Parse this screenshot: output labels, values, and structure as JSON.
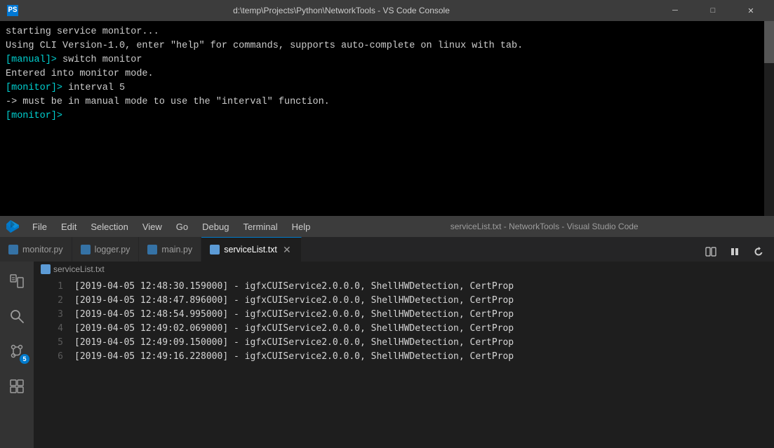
{
  "titleBar": {
    "icon": "PS",
    "title": "d:\\temp\\Projects\\Python\\NetworkTools - VS Code Console",
    "minimize": "─",
    "restore": "□",
    "close": "✕"
  },
  "terminal": {
    "lines": [
      "starting service monitor...",
      "Using CLI Version-1.0, enter \"help\" for commands, supports auto-complete on linux with tab.",
      "[manual]> switch monitor",
      "Entered into monitor mode.",
      "[monitor]> interval 5",
      "-> must be in manual mode to use the \"interval\" function.",
      "[monitor]> "
    ]
  },
  "menuBar": {
    "items": [
      "File",
      "Edit",
      "Selection",
      "View",
      "Go",
      "Debug",
      "Terminal",
      "Help"
    ],
    "centerTitle": "serviceList.txt - NetworkTools - Visual Studio Code"
  },
  "tabs": [
    {
      "id": "monitor-py",
      "label": "monitor.py",
      "iconColor": "#3572A5",
      "active": false,
      "closeable": false
    },
    {
      "id": "logger-py",
      "label": "logger.py",
      "iconColor": "#3572A5",
      "active": false,
      "closeable": false
    },
    {
      "id": "main-py",
      "label": "main.py",
      "iconColor": "#3572A5",
      "active": false,
      "closeable": false
    },
    {
      "id": "serviceList-txt",
      "label": "serviceList.txt",
      "iconColor": "#5c9bd6",
      "active": true,
      "closeable": true
    }
  ],
  "breadcrumb": {
    "filename": "serviceList.txt"
  },
  "editorLines": [
    {
      "num": 1,
      "text": "[2019-04-05 12:48:30.159000] - igfxCUIService2.0.0.0,  ShellHWDetection,  CertProp"
    },
    {
      "num": 2,
      "text": "[2019-04-05 12:48:47.896000] - igfxCUIService2.0.0.0,  ShellHWDetection,  CertProp"
    },
    {
      "num": 3,
      "text": "[2019-04-05 12:48:54.995000] - igfxCUIService2.0.0.0,  ShellHWDetection,  CertProp"
    },
    {
      "num": 4,
      "text": "[2019-04-05 12:49:02.069000] - igfxCUIService2.0.0.0,  ShellHWDetection,  CertProp"
    },
    {
      "num": 5,
      "text": "[2019-04-05 12:49:09.150000] - igfxCUIService2.0.0.0,  ShellHWDetection,  CertProp"
    },
    {
      "num": 6,
      "text": "[2019-04-05 12:49:16.228000] - igfxCUIService2.0.0.0,  ShellHWDetection,  CertProp"
    }
  ],
  "sidebar": {
    "items": [
      {
        "id": "explorer",
        "icon": "⬜",
        "iconName": "explorer-icon",
        "active": false
      },
      {
        "id": "search",
        "icon": "🔍",
        "iconName": "search-icon",
        "active": false
      },
      {
        "id": "source-control",
        "icon": "⑂",
        "iconName": "source-control-icon",
        "active": false,
        "badge": "5"
      },
      {
        "id": "extensions",
        "icon": "⊞",
        "iconName": "extensions-icon",
        "active": false
      }
    ]
  }
}
